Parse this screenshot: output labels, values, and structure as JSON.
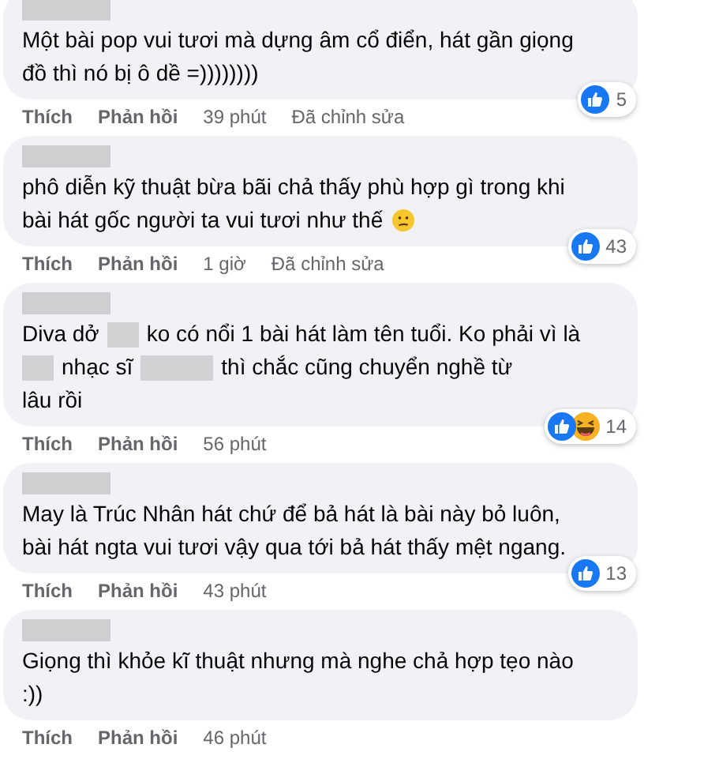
{
  "comments": [
    {
      "lines": [
        [
          {
            "kind": "text",
            "text": "Một bài pop vui tươi mà dựng âm cổ điển, hát gần giọng"
          }
        ],
        [
          {
            "kind": "text",
            "text": "đồ thì nó bị ô dề =))))))))"
          }
        ]
      ],
      "actions": [
        "Thích",
        "Phản hồi"
      ],
      "time": "39 phút",
      "edited": "Đã chỉnh sửa",
      "reactions": [
        {
          "kind": "like"
        }
      ],
      "reaction_count": "5"
    },
    {
      "lines": [
        [
          {
            "kind": "text",
            "text": "phô diễn kỹ thuật bừa bãi chả thấy phù hợp gì trong khi"
          }
        ],
        [
          {
            "kind": "text",
            "text": "bài hát gốc người ta vui tươi như thế"
          },
          {
            "kind": "confused_emoji"
          }
        ]
      ],
      "actions": [
        "Thích",
        "Phản hồi"
      ],
      "time": "1 giờ",
      "edited": "Đã chỉnh sửa",
      "reactions": [
        {
          "kind": "like"
        }
      ],
      "reaction_count": "43"
    },
    {
      "lines": [
        [
          {
            "kind": "text",
            "text": "Diva dở"
          },
          {
            "kind": "redacted"
          },
          {
            "kind": "text",
            "text": "ko có nổi 1 bài hát làm tên tuổi. Ko phải vì là"
          }
        ],
        [
          {
            "kind": "redacted"
          },
          {
            "kind": "text",
            "text": "nhạc sĩ"
          },
          {
            "kind": "redacted"
          },
          {
            "kind": "text",
            "text": "thì chắc cũng chuyển nghề từ"
          }
        ],
        [
          {
            "kind": "text",
            "text": "lâu rồi"
          }
        ]
      ],
      "actions": [
        "Thích",
        "Phản hồi"
      ],
      "time": "56 phút",
      "reactions": [
        {
          "kind": "like"
        },
        {
          "kind": "haha"
        }
      ],
      "reaction_count": "14"
    },
    {
      "lines": [
        [
          {
            "kind": "text",
            "text": "May là Trúc Nhân hát chứ để bả hát là bài này bỏ luôn,"
          }
        ],
        [
          {
            "kind": "text",
            "text": "bài hát ngta vui tươi vậy qua tới bả hát thấy mệt ngang."
          }
        ]
      ],
      "actions": [
        "Thích",
        "Phản hồi"
      ],
      "time": "43 phút",
      "reactions": [
        {
          "kind": "like"
        }
      ],
      "reaction_count": "13"
    },
    {
      "lines": [
        [
          {
            "kind": "text",
            "text": "Giọng thì khỏe kĩ thuật nhưng mà nghe chả hợp tẹo nào"
          }
        ],
        [
          {
            "kind": "text",
            "text": ":))"
          }
        ]
      ],
      "actions": [
        "Thích",
        "Phản hồi"
      ],
      "time": "46 phút"
    }
  ]
}
